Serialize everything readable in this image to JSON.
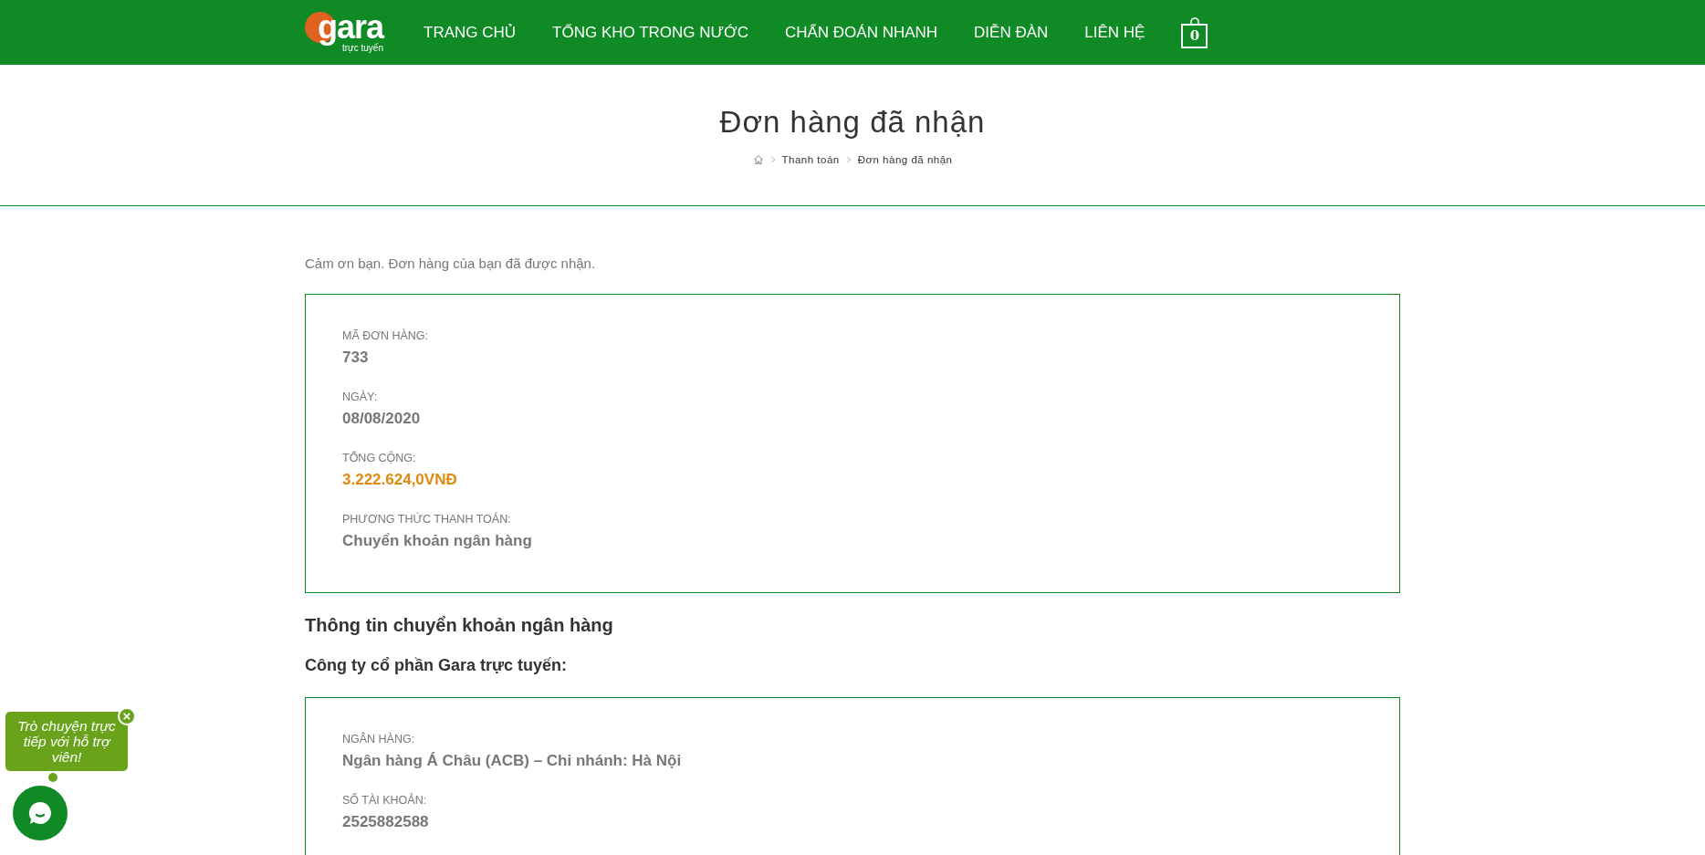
{
  "header": {
    "logo": {
      "name": "gara",
      "tagline": "trực tuyến"
    },
    "nav": [
      {
        "label": "TRANG CHỦ"
      },
      {
        "label": "TỔNG KHO TRONG NƯỚC"
      },
      {
        "label": "CHẨN ĐOÁN NHANH"
      },
      {
        "label": "DIỄN ĐÀN"
      },
      {
        "label": "LIÊN HỆ"
      }
    ],
    "cart": {
      "count": "0"
    }
  },
  "page_title": "Đơn hàng đã nhận",
  "breadcrumb": [
    {
      "label": "Thanh toán"
    },
    {
      "label": "Đơn hàng đã nhận"
    }
  ],
  "thank_you": "Cảm ơn bạn. Đơn hàng của bạn đã được nhận.",
  "order_details": [
    {
      "label": "MÃ ĐƠN HÀNG:",
      "value": "733",
      "kind": "plain"
    },
    {
      "label": "NGÀY:",
      "value": "08/08/2020",
      "kind": "plain"
    },
    {
      "label": "TỔNG CỘNG:",
      "value": "3.222.624,0VNĐ",
      "kind": "price"
    },
    {
      "label": "PHƯƠNG THỨC THANH TOÁN:",
      "value": "Chuyển khoản ngân hàng",
      "kind": "plain"
    }
  ],
  "bank_section": {
    "heading": "Thông tin chuyển khoản ngân hàng",
    "company": "Công ty cổ phần Gara trực tuyến:",
    "details": [
      {
        "label": "NGÂN HÀNG:",
        "value": "Ngân hàng Á Châu (ACB)  – Chi nhánh: Hà Nội"
      },
      {
        "label": "SỐ TÀI KHOẢN:",
        "value": "2525882588"
      }
    ]
  },
  "chat": {
    "prompt": "Trò chuyện trực tiếp với hỗ trợ viên!",
    "close": "×"
  }
}
